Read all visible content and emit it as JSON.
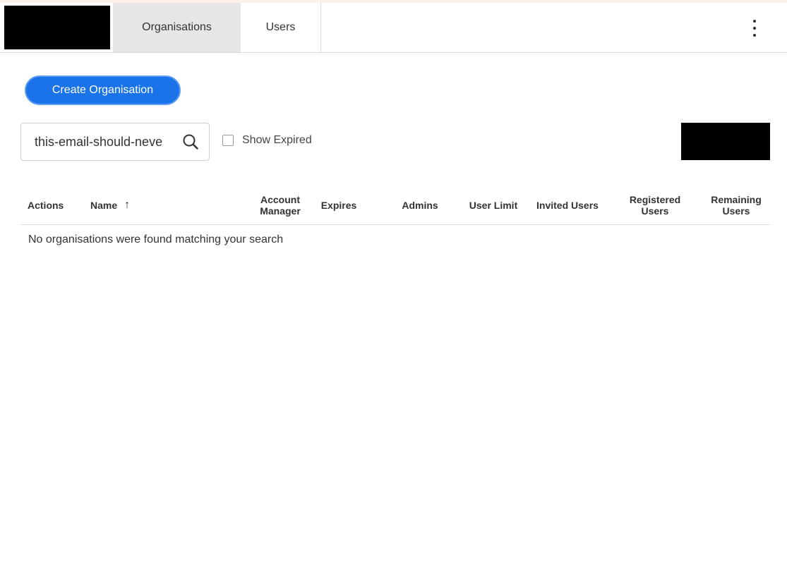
{
  "nav": {
    "tabs": [
      {
        "label": "Organisations",
        "active": true
      },
      {
        "label": "Users",
        "active": false
      }
    ],
    "menu_icon": "kebab-menu-icon"
  },
  "toolbar": {
    "create_label": "Create Organisation"
  },
  "search": {
    "value": "this-email-should-neve",
    "icon": "search-icon"
  },
  "filters": {
    "show_expired_label": "Show Expired",
    "show_expired_checked": false
  },
  "table": {
    "columns": [
      {
        "key": "actions",
        "label": "Actions"
      },
      {
        "key": "name",
        "label": "Name",
        "sort": "ascending",
        "sort_glyph": "↑"
      },
      {
        "key": "account_manager",
        "label": "Account Manager"
      },
      {
        "key": "expires",
        "label": "Expires"
      },
      {
        "key": "admins",
        "label": "Admins"
      },
      {
        "key": "user_limit",
        "label": "User Limit"
      },
      {
        "key": "invited_users",
        "label": "Invited Users"
      },
      {
        "key": "registered_users",
        "label": "Registered Users"
      },
      {
        "key": "remaining_users",
        "label": "Remaining Users"
      }
    ],
    "empty_message": "No organisations were found matching your search"
  },
  "colors": {
    "primary": "#1a73e8",
    "active_tab_bg": "#e6e6e9",
    "page_bg": "#fdf1ea"
  }
}
